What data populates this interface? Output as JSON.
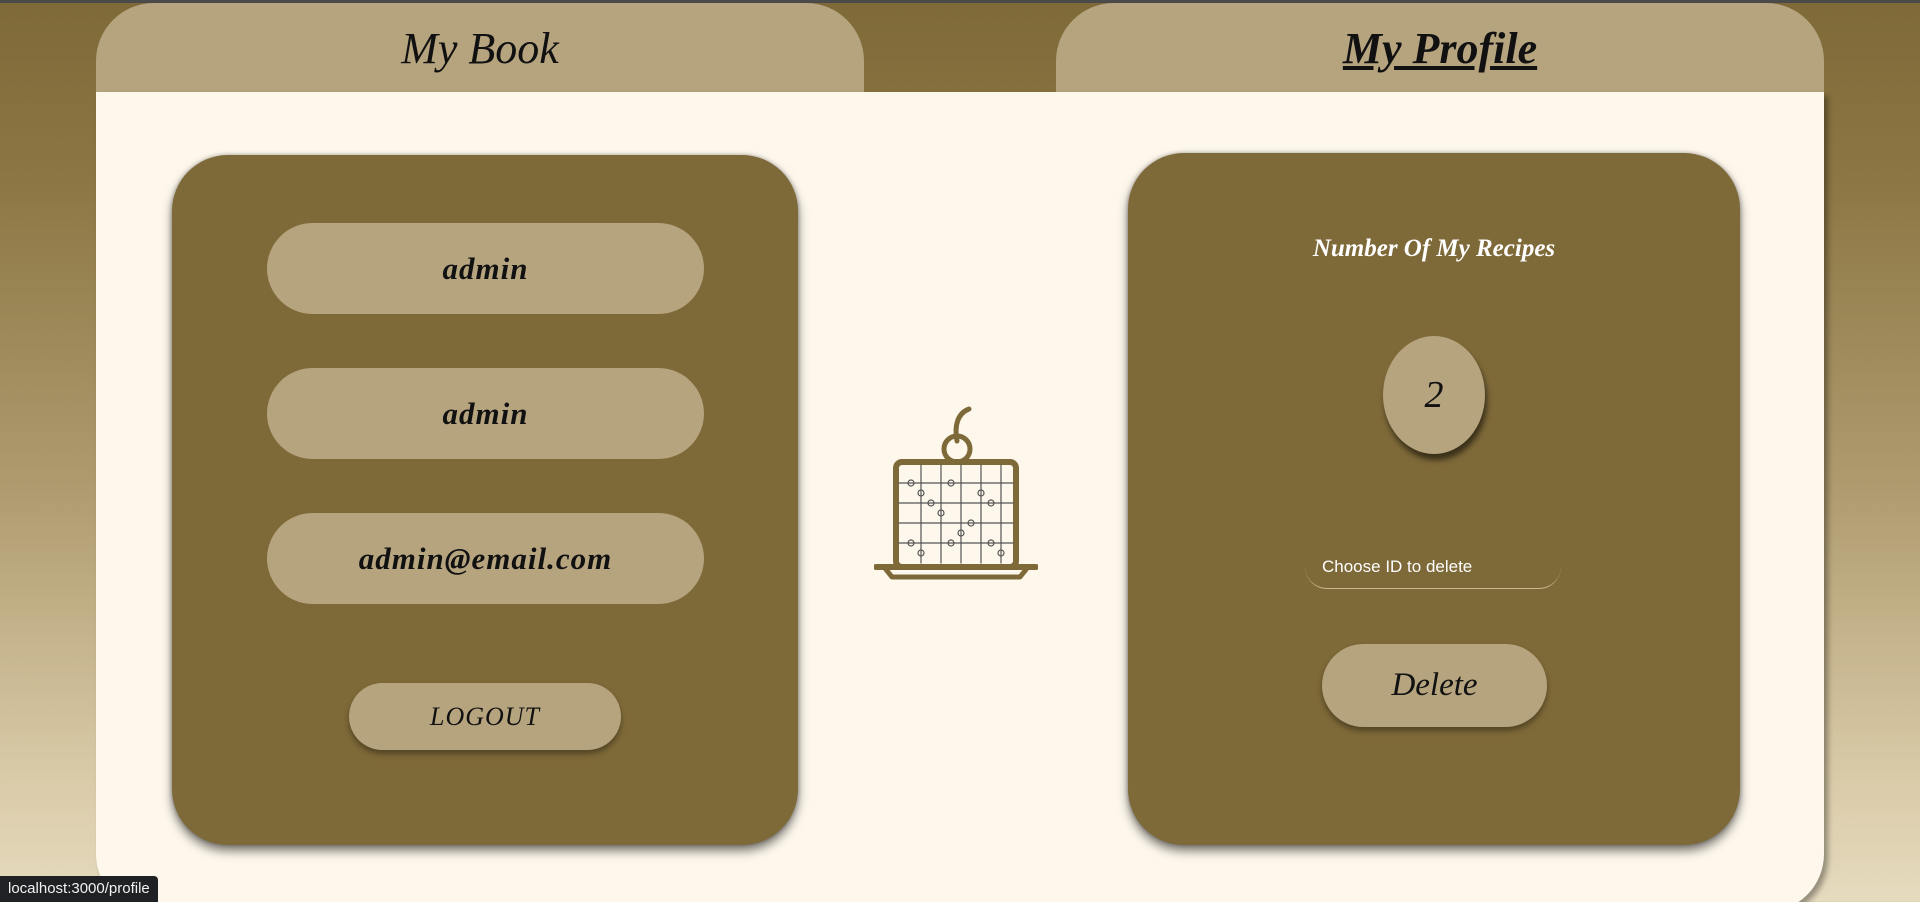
{
  "nav": {
    "book_label": "My Book",
    "profile_label": "My Profile"
  },
  "profile": {
    "username": "admin",
    "name": "admin",
    "email": "admin@email.com",
    "logout_label": "LOGOUT"
  },
  "recipes": {
    "heading": "Number Of My Recipes",
    "count": "2",
    "delete_placeholder": "Choose ID to delete",
    "delete_label": "Delete"
  },
  "status_bar": {
    "url": "localhost:3000/profile"
  },
  "colors": {
    "brand_dark": "#7e6938",
    "brand_light": "#b6a47f",
    "panel_bg": "#fdf7ec"
  },
  "icons": {
    "center_illustration": "cake-puzzle-icon"
  }
}
